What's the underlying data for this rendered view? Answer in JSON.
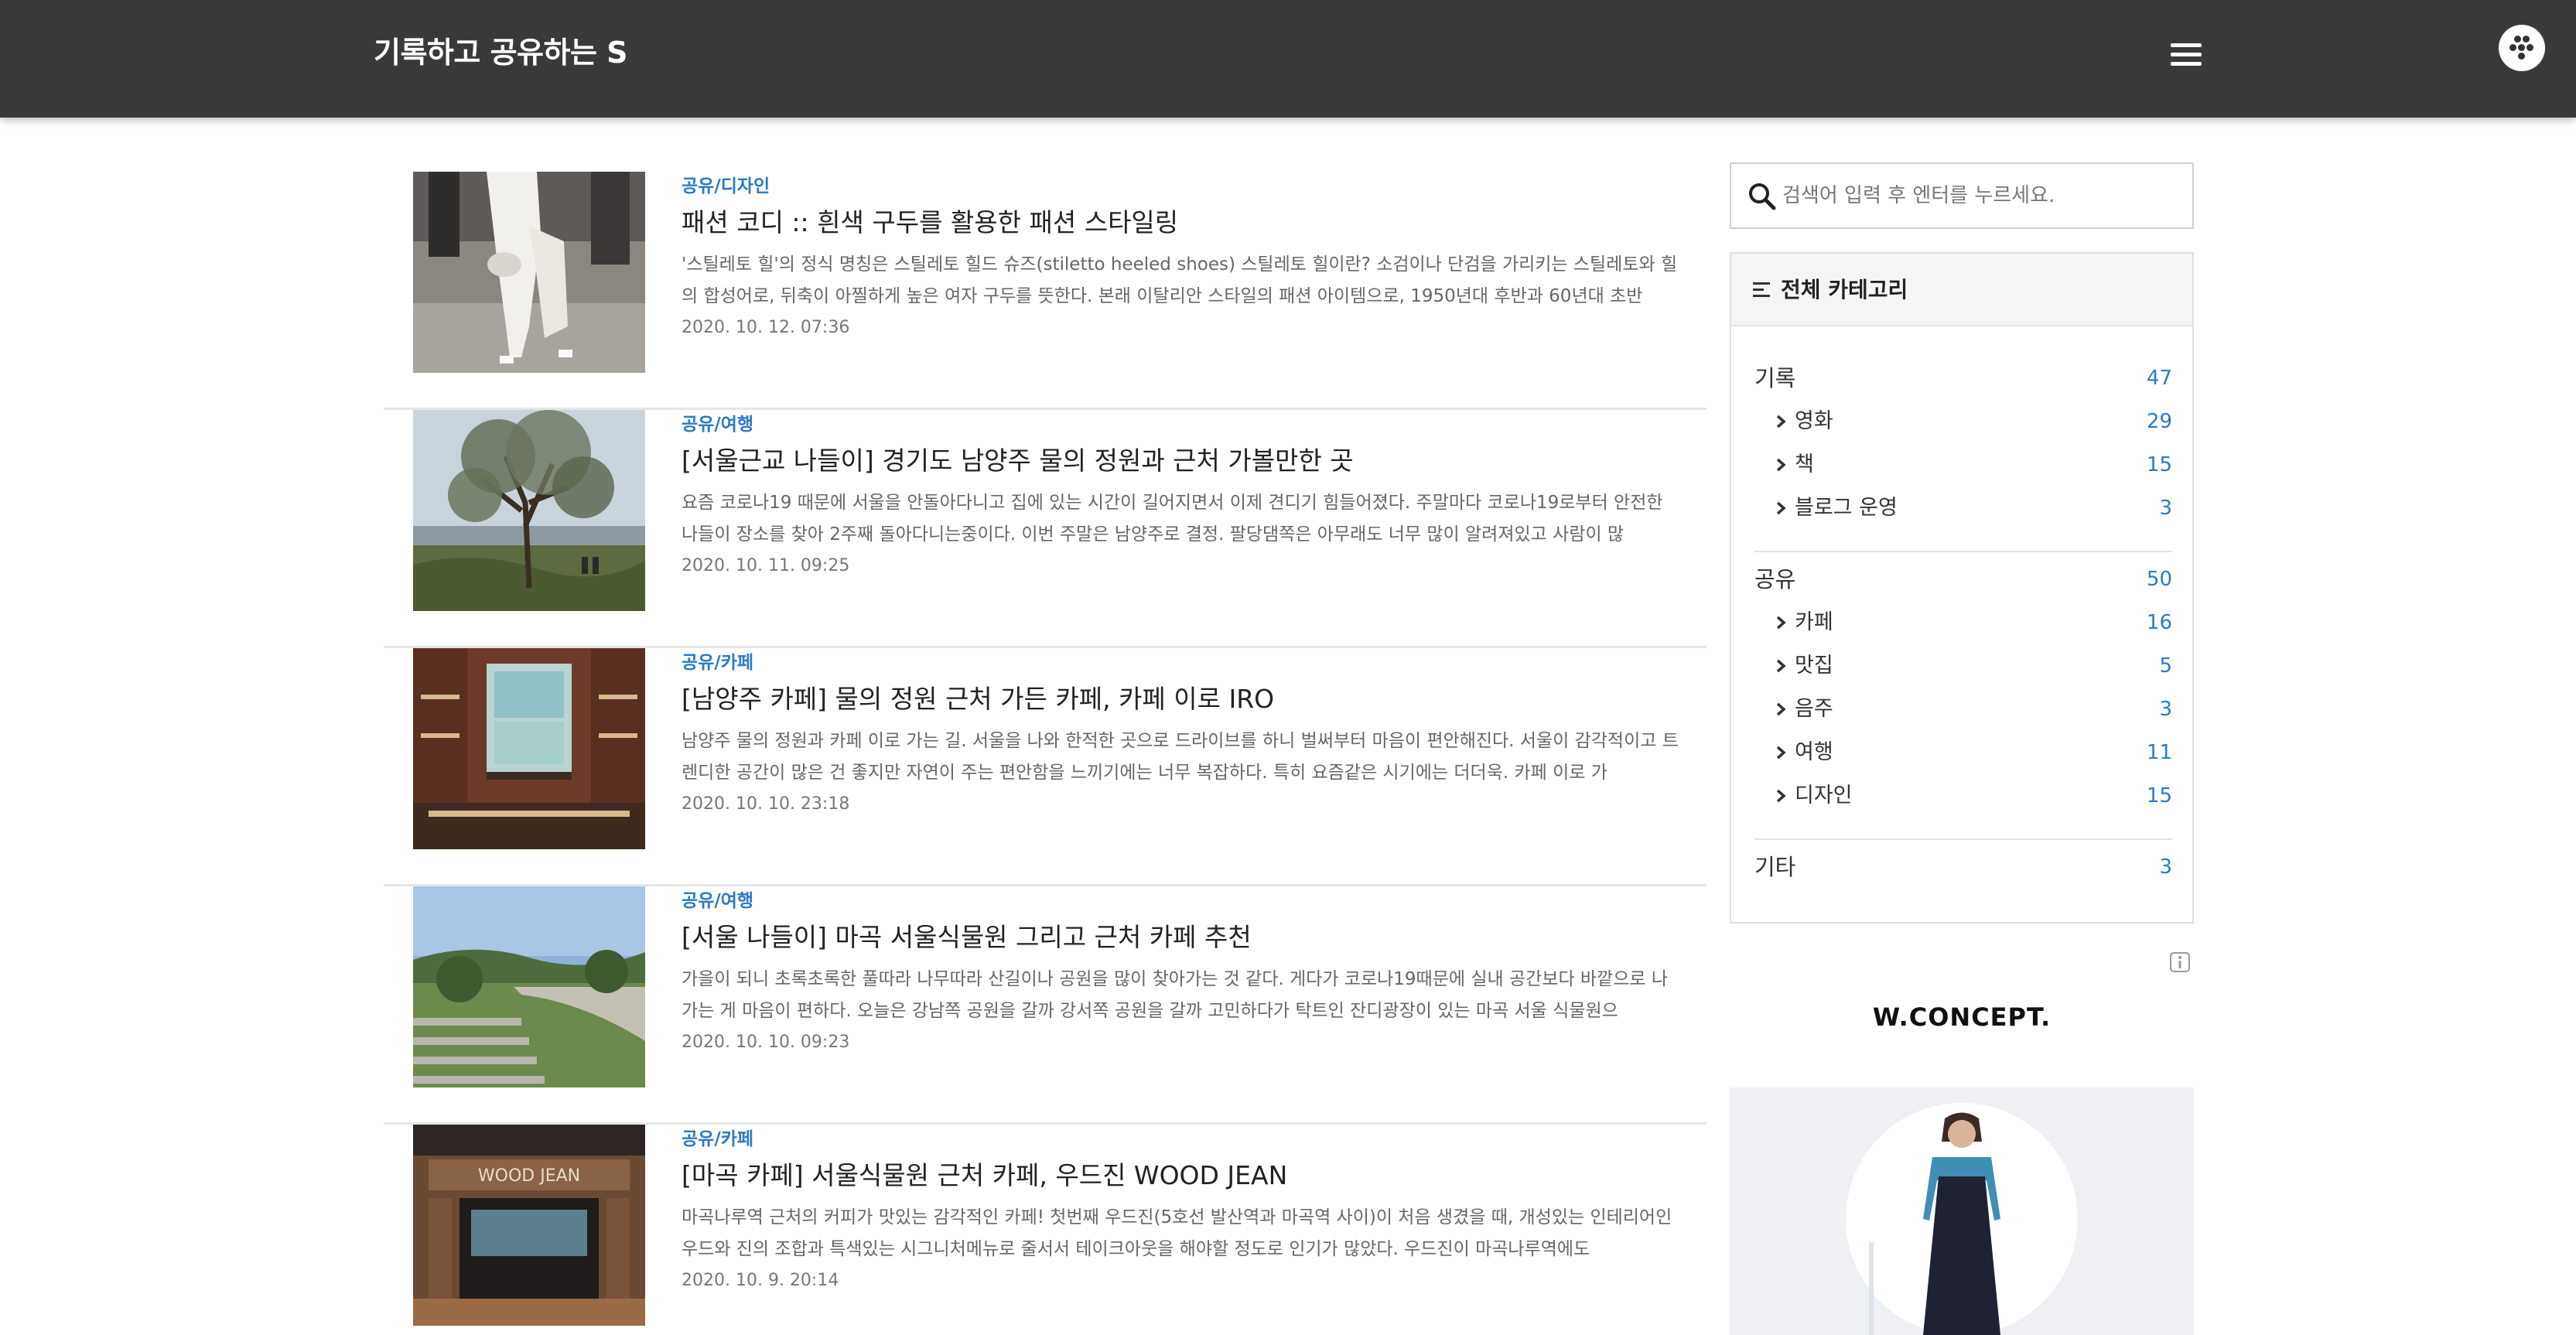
{
  "header": {
    "blog_title": "기록하고 공유하는 S",
    "menu_icon": "hamburger-menu-icon",
    "profile_icon": "dots-profile-icon"
  },
  "posts": [
    {
      "category": "공유/디자인",
      "title": "패션 코디 :: 흰색 구두를 활용한 패션 스타일링",
      "excerpt": "'스틸레토 힐'의 정식 명칭은 스틸레토 힐드 슈즈(stiletto heeled shoes) 스틸레토 힐이란? 소검이나 단검을 가리키는 스틸레토와 힐의 합성어로, 뒤축이 아찔하게 높은 여자 구두를 뜻한다. 본래 이탈리안 스타일의 패션 아이템으로, 1950년대 후반과 60년대 초반",
      "date": "2020. 10. 12. 07:36"
    },
    {
      "category": "공유/여행",
      "title": "[서울근교 나들이] 경기도 남양주 물의 정원과 근처 가볼만한 곳",
      "excerpt": "요즘 코로나19 때문에 서울을 안돌아다니고 집에 있는 시간이 길어지면서 이제 견디기 힘들어졌다. 주말마다 코로나19로부터 안전한 나들이 장소를 찾아 2주째 돌아다니는중이다. 이번 주말은 남양주로 결정. 팔당댐쪽은 아무래도 너무 많이 알려져있고 사람이 많",
      "date": "2020. 10. 11. 09:25"
    },
    {
      "category": "공유/카페",
      "title": "[남양주 카페] 물의 정원 근처 가든 카페, 카페 이로 IRO",
      "excerpt": "남양주 물의 정원과 카페 이로 가는 길. 서울을 나와 한적한 곳으로 드라이브를 하니 벌써부터 마음이 편안해진다. 서울이 감각적이고 트렌디한 공간이 많은 건 좋지만 자연이 주는 편안함을 느끼기에는 너무 복잡하다. 특히 요즘같은 시기에는 더더욱. 카페 이로 가",
      "date": "2020. 10. 10. 23:18"
    },
    {
      "category": "공유/여행",
      "title": "[서울 나들이] 마곡 서울식물원 그리고 근처 카페 추천",
      "excerpt": "가을이 되니 초록초록한 풀따라 나무따라 산길이나 공원을 많이 찾아가는 것 같다. 게다가 코로나19때문에 실내 공간보다 바깥으로 나가는 게 마음이 편하다. 오늘은 강남쪽 공원을 갈까 강서쪽 공원을 갈까 고민하다가 탁트인 잔디광장이 있는 마곡 서울 식물원으",
      "date": "2020. 10. 10. 09:23"
    },
    {
      "category": "공유/카페",
      "title": "[마곡 카페] 서울식물원 근처 카페, 우드진 WOOD JEAN",
      "excerpt": "마곡나루역 근처의 커피가 맛있는 감각적인 카페! 첫번째 우드진(5호선 발산역과 마곡역 사이)이 처음 생겼을 때, 개성있는 인테리어인 우드와 진의 조합과 특색있는 시그니처메뉴로 줄서서 테이크아웃을 해야할 정도로 인기가 많았다. 우드진이 마곡나루역에도",
      "date": "2020. 10. 9. 20:14",
      "thumb_sign": "WOOD JEAN"
    }
  ],
  "sidebar": {
    "search": {
      "placeholder": "검색어 입력 후 엔터를 누르세요.",
      "value": ""
    },
    "categories": {
      "heading": "전체 카테고리",
      "groups": [
        {
          "name": "기록",
          "count": "47",
          "children": [
            {
              "name": "영화",
              "count": "29"
            },
            {
              "name": "책",
              "count": "15"
            },
            {
              "name": "블로그 운영",
              "count": "3"
            }
          ]
        },
        {
          "name": "공유",
          "count": "50",
          "children": [
            {
              "name": "카페",
              "count": "16"
            },
            {
              "name": "맛집",
              "count": "5"
            },
            {
              "name": "음주",
              "count": "3"
            },
            {
              "name": "여행",
              "count": "11"
            },
            {
              "name": "디자인",
              "count": "15"
            }
          ]
        },
        {
          "name": "기타",
          "count": "3",
          "children": []
        }
      ]
    },
    "ad": {
      "brand": "W.CONCEPT.",
      "info_icon": "info-icon"
    }
  }
}
